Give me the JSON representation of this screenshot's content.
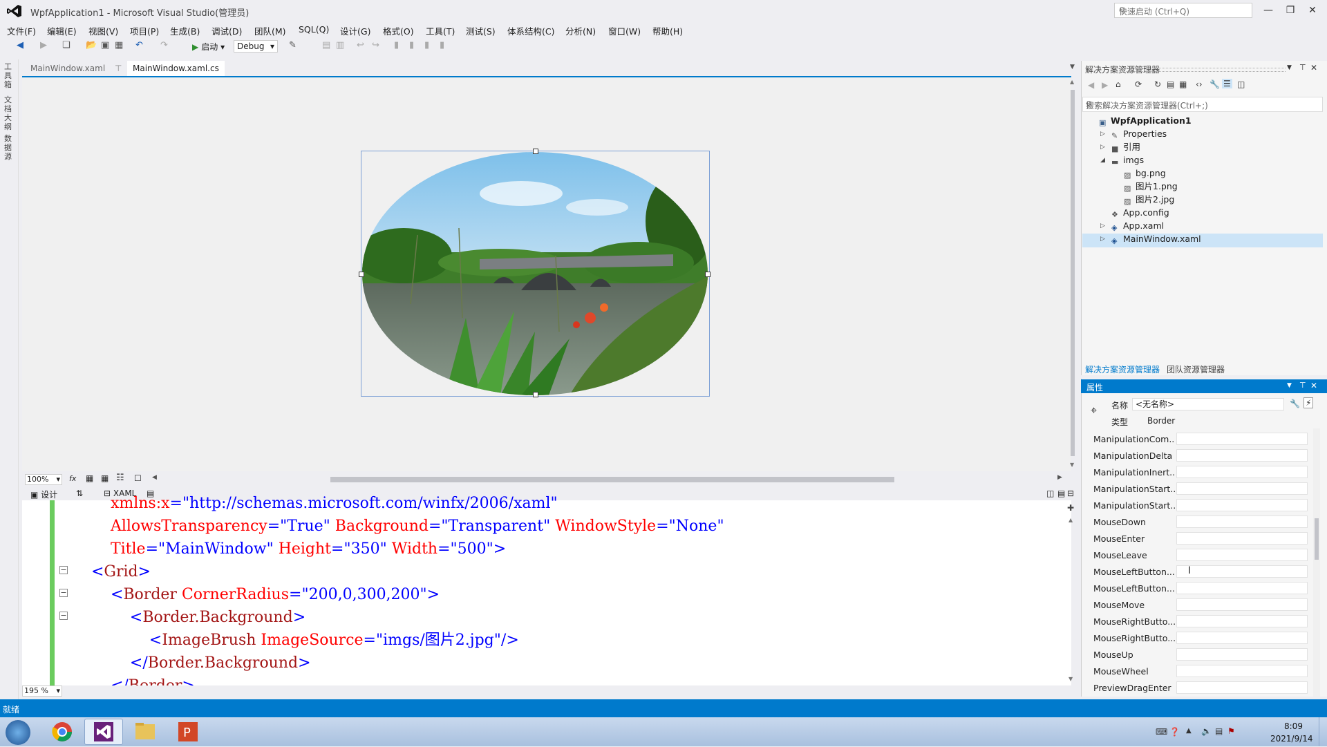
{
  "window": {
    "title": "WpfApplication1 - Microsoft Visual Studio(管理员)",
    "quick_launch_placeholder": "快速启动 (Ctrl+Q)"
  },
  "menu": [
    "文件(F)",
    "编辑(E)",
    "视图(V)",
    "项目(P)",
    "生成(B)",
    "调试(D)",
    "团队(M)",
    "SQL(Q)",
    "设计(G)",
    "格式(O)",
    "工具(T)",
    "测试(S)",
    "体系结构(C)",
    "分析(N)",
    "窗口(W)",
    "帮助(H)"
  ],
  "toolbar": {
    "start_label": "启动",
    "config": "Debug"
  },
  "left_strip": [
    "工具箱",
    "文档大纲",
    "数据源"
  ],
  "tabs": [
    {
      "label": "MainWindow.xaml",
      "active": false
    },
    {
      "label": "MainWindow.xaml.cs",
      "active": true
    }
  ],
  "designer": {
    "zoom": "100%",
    "view_design": "设计",
    "view_xaml": "XAML"
  },
  "xaml": {
    "zoom": "195 %",
    "lines": [
      {
        "parts": [
          [
            "attr",
            "xmlns:x"
          ],
          [
            "punc",
            "=\""
          ],
          [
            "val",
            "http://schemas.microsoft.com/winfx/2006/xaml"
          ],
          [
            "punc",
            "\""
          ]
        ],
        "indent": "        "
      },
      {
        "parts": [
          [
            "attr",
            "AllowsTransparency"
          ],
          [
            "punc",
            "=\""
          ],
          [
            "val",
            "True"
          ],
          [
            "punc",
            "\" "
          ],
          [
            "attr",
            "Background"
          ],
          [
            "punc",
            "=\""
          ],
          [
            "val",
            "Transparent"
          ],
          [
            "punc",
            "\" "
          ],
          [
            "attr",
            "WindowStyle"
          ],
          [
            "punc",
            "=\""
          ],
          [
            "val",
            "None"
          ],
          [
            "punc",
            "\""
          ]
        ],
        "indent": "        "
      },
      {
        "parts": [
          [
            "attr",
            "Title"
          ],
          [
            "punc",
            "=\""
          ],
          [
            "val",
            "MainWindow"
          ],
          [
            "punc",
            "\" "
          ],
          [
            "attr",
            "Height"
          ],
          [
            "punc",
            "=\""
          ],
          [
            "val",
            "350"
          ],
          [
            "punc",
            "\" "
          ],
          [
            "attr",
            "Width"
          ],
          [
            "punc",
            "=\""
          ],
          [
            "val",
            "500"
          ],
          [
            "punc",
            "\">"
          ]
        ],
        "indent": "        "
      },
      {
        "parts": [
          [
            "punc",
            "<"
          ],
          [
            "tag",
            "Grid"
          ],
          [
            "punc",
            ">"
          ]
        ],
        "indent": "    "
      },
      {
        "parts": [
          [
            "punc",
            "<"
          ],
          [
            "tag",
            "Border"
          ],
          [
            "punc",
            " "
          ],
          [
            "attr",
            "CornerRadius"
          ],
          [
            "punc",
            "=\""
          ],
          [
            "val",
            "200,0,300,200"
          ],
          [
            "punc",
            "\">"
          ]
        ],
        "indent": "        "
      },
      {
        "parts": [
          [
            "punc",
            "<"
          ],
          [
            "tag",
            "Border.Background"
          ],
          [
            "punc",
            ">"
          ]
        ],
        "indent": "            "
      },
      {
        "parts": [
          [
            "punc",
            "<"
          ],
          [
            "tag",
            "ImageBrush"
          ],
          [
            "punc",
            " "
          ],
          [
            "attr",
            "ImageSource"
          ],
          [
            "punc",
            "=\""
          ],
          [
            "val",
            "imgs/图片2.jpg"
          ],
          [
            "punc",
            "\"/>"
          ]
        ],
        "indent": "                "
      },
      {
        "parts": [
          [
            "punc",
            "</"
          ],
          [
            "tag",
            "Border.Background"
          ],
          [
            "punc",
            ">"
          ]
        ],
        "indent": "            "
      },
      {
        "parts": [
          [
            "punc",
            "</"
          ],
          [
            "tag",
            "Border"
          ],
          [
            "punc",
            ">"
          ]
        ],
        "indent": "        "
      }
    ]
  },
  "solution_explorer": {
    "title": "解决方案资源管理器",
    "search_placeholder": "搜索解决方案资源管理器(Ctrl+;)",
    "items": [
      {
        "label": "WpfApplication1",
        "depth": 0,
        "arrow": "",
        "icon": "project"
      },
      {
        "label": "Properties",
        "depth": 1,
        "arrow": "▷",
        "icon": "wrench"
      },
      {
        "label": "引用",
        "depth": 1,
        "arrow": "▷",
        "icon": "refs"
      },
      {
        "label": "imgs",
        "depth": 1,
        "arrow": "◢",
        "icon": "folder"
      },
      {
        "label": "bg.png",
        "depth": 2,
        "arrow": "",
        "icon": "image"
      },
      {
        "label": "图片1.png",
        "depth": 2,
        "arrow": "",
        "icon": "image"
      },
      {
        "label": "图片2.jpg",
        "depth": 2,
        "arrow": "",
        "icon": "image"
      },
      {
        "label": "App.config",
        "depth": 1,
        "arrow": "",
        "icon": "config"
      },
      {
        "label": "App.xaml",
        "depth": 1,
        "arrow": "▷",
        "icon": "xaml"
      },
      {
        "label": "MainWindow.xaml",
        "depth": 1,
        "arrow": "▷",
        "icon": "xaml"
      }
    ],
    "bottom_tabs": [
      "解决方案资源管理器",
      "团队资源管理器"
    ]
  },
  "properties": {
    "title": "属性",
    "name_label": "名称",
    "name_value": "<无名称>",
    "type_label": "类型",
    "type_value": "Border",
    "events": [
      "ManipulationCom...",
      "ManipulationDelta",
      "ManipulationInert...",
      "ManipulationStart...",
      "ManipulationStart...",
      "MouseDown",
      "MouseEnter",
      "MouseLeave",
      "MouseLeftButton...",
      "MouseLeftButton...",
      "MouseMove",
      "MouseRightButto...",
      "MouseRightButto...",
      "MouseUp",
      "MouseWheel",
      "PreviewDragEnter"
    ]
  },
  "status": {
    "text": "就绪"
  },
  "taskbar": {
    "time": "8:09",
    "date": "2021/9/14"
  },
  "colors": {
    "accent": "#007acc",
    "selection": "#cce4f7",
    "change_marker": "#6bcc5e"
  }
}
